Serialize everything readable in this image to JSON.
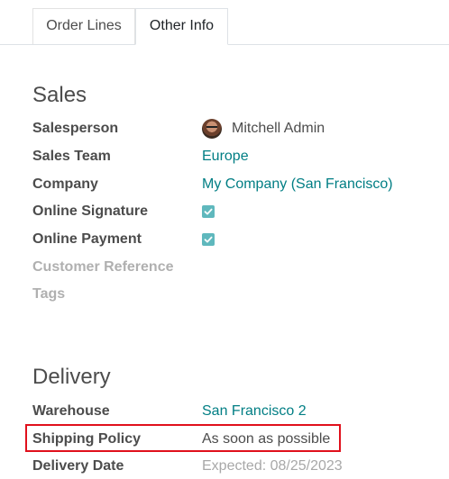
{
  "tabs": [
    {
      "label": "Order Lines"
    },
    {
      "label": "Other Info"
    }
  ],
  "sales": {
    "title": "Sales",
    "salesperson_label": "Salesperson",
    "salesperson_value": "Mitchell Admin",
    "sales_team_label": "Sales Team",
    "sales_team_value": "Europe",
    "company_label": "Company",
    "company_value": "My Company (San Francisco)",
    "online_signature_label": "Online Signature",
    "online_signature_checked": true,
    "online_payment_label": "Online Payment",
    "online_payment_checked": true,
    "customer_reference_label": "Customer Reference",
    "tags_label": "Tags"
  },
  "delivery": {
    "title": "Delivery",
    "warehouse_label": "Warehouse",
    "warehouse_value": "San Francisco 2",
    "shipping_policy_label": "Shipping Policy",
    "shipping_policy_value": "As soon as possible",
    "delivery_date_label": "Delivery Date",
    "delivery_date_value": "Expected: 08/25/2023"
  },
  "colors": {
    "link": "#017e84",
    "checkbox": "#5fb8bd",
    "highlight": "#e0101c"
  },
  "icons": {
    "checkbox": "check-icon",
    "avatar": "user-avatar"
  }
}
